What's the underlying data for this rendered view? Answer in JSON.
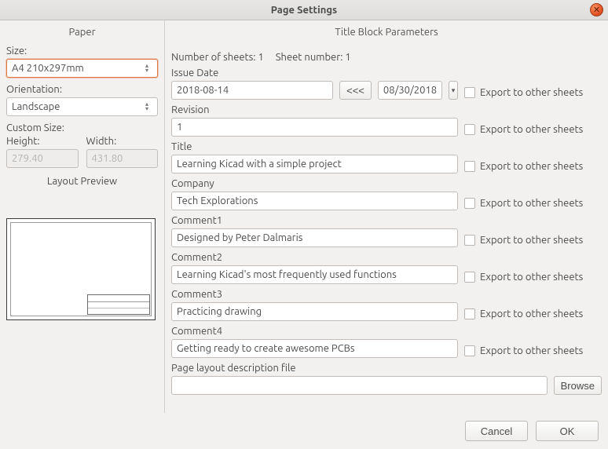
{
  "window": {
    "title": "Page Settings"
  },
  "paper": {
    "heading": "Paper",
    "size_label": "Size:",
    "size_value": "A4 210x297mm",
    "orientation_label": "Orientation:",
    "orientation_value": "Landscape",
    "custom_label": "Custom Size:",
    "height_label": "Height:",
    "height_value": "279.40",
    "width_label": "Width:",
    "width_value": "431.80",
    "preview_label": "Layout Preview"
  },
  "tbp": {
    "heading": "Title Block Parameters",
    "sheets_label": "Number of sheets: 1",
    "sheetnum_label": "Sheet number: 1",
    "export_label": "Export to other sheets",
    "issue_date": {
      "label": "Issue Date",
      "value": "2018-08-14",
      "btn": "<<<",
      "picker": "08/30/2018"
    },
    "revision": {
      "label": "Revision",
      "value": "1"
    },
    "title": {
      "label": "Title",
      "value": "Learning Kicad with a simple project"
    },
    "company": {
      "label": "Company",
      "value": "Tech Explorations"
    },
    "comment1": {
      "label": "Comment1",
      "value": "Designed by Peter Dalmaris"
    },
    "comment2": {
      "label": "Comment2",
      "value": "Learning Kicad's most frequently used functions"
    },
    "comment3": {
      "label": "Comment3",
      "value": "Practicing drawing"
    },
    "comment4": {
      "label": "Comment4",
      "value": "Getting ready to create awesome PCBs"
    },
    "layout_file": {
      "label": "Page layout description file",
      "value": "",
      "browse": "Browse"
    }
  },
  "buttons": {
    "cancel": "Cancel",
    "ok": "OK"
  }
}
